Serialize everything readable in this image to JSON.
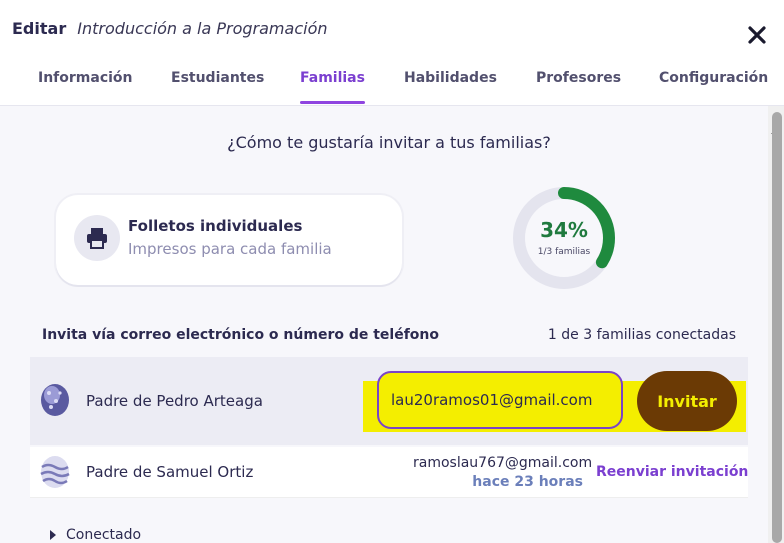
{
  "header": {
    "title": "Editar",
    "subtitle": "Introducción a la Programación"
  },
  "tabs": [
    {
      "label": "Información"
    },
    {
      "label": "Estudiantes"
    },
    {
      "label": "Familias"
    },
    {
      "label": "Habilidades"
    },
    {
      "label": "Profesores"
    },
    {
      "label": "Configuración"
    }
  ],
  "active_tab": "Familias",
  "question": "¿Cómo te gustaría invitar a tus familias?",
  "flyer": {
    "title": "Folletos individuales",
    "subtitle": "Impresos para cada familia",
    "icon": "printer-icon"
  },
  "progress": {
    "percent_label": "34%",
    "sub_label": "1/3 familias",
    "fraction": 0.34
  },
  "invite_label": "Invita vía correo electrónico o número de teléfono",
  "connected_count": "1 de 3 familias conectadas",
  "families": [
    {
      "name": "Padre de Pedro Arteaga",
      "email": "lau20ramos01@gmail.com",
      "action": "Invitar"
    },
    {
      "name": "Padre de Samuel Ortiz",
      "email": "ramoslau767@gmail.com",
      "time": "hace 23 horas",
      "action": "Reenviar invitación"
    }
  ],
  "connected_section": "Conectado",
  "colors": {
    "accent": "#7b3fd0",
    "highlight": "#f4ee00",
    "invite_button": "#6b3a05",
    "progress": "#1f8a3e"
  }
}
